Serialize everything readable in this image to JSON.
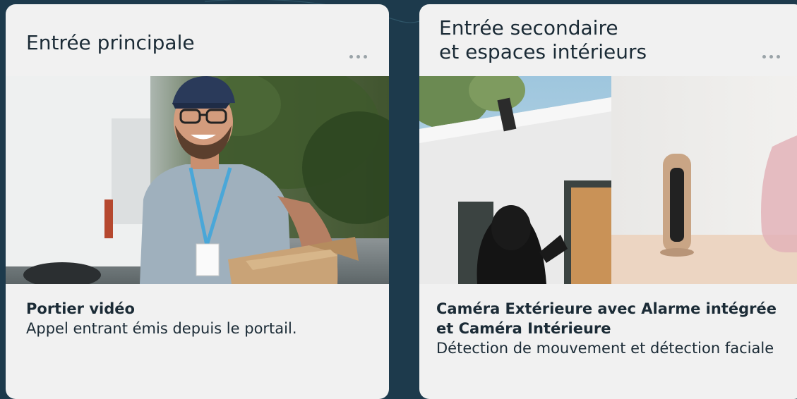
{
  "cards": [
    {
      "title": "Entrée principale",
      "image_alt": "Livreur souriant portant des colis",
      "product": "Portier vidéo",
      "description": "Appel entrant émis depuis le portail."
    },
    {
      "title": "Entrée secondaire\net espaces intérieurs",
      "image_alt": "Caméra extérieure, intrus encapuchonné et caméra intérieure",
      "product": "Caméra Extérieure avec Alarme intégrée et Caméra Intérieure",
      "description": "Détection de mouvement et détection faciale"
    }
  ],
  "icons": {
    "more": "more-horizontal-icon"
  },
  "colors": {
    "page_background": "#1d3a4c",
    "card_background": "#f1f1f1",
    "text": "#1b2b36"
  }
}
